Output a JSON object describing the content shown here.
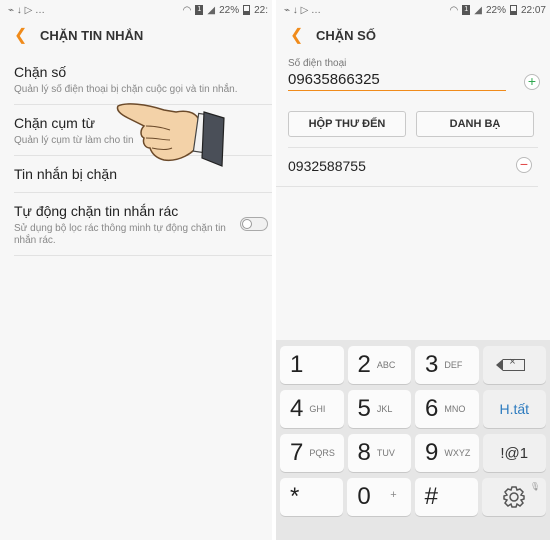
{
  "left": {
    "status": {
      "left_icons": "⌁ ↓ ▷ …",
      "battery": "22%",
      "time": "22:"
    },
    "title": "CHẶN TIN NHẮN",
    "rows": [
      {
        "title": "Chặn số",
        "subtitle": "Quản lý số điện thoại bị chặn cuộc gọi và tin nhắn."
      },
      {
        "title": "Chặn cụm từ",
        "subtitle": "Quản lý cụm từ làm cho tin"
      },
      {
        "title": "Tin nhắn bị chặn",
        "subtitle": ""
      },
      {
        "title": "Tự động chặn tin nhắn rác",
        "subtitle": "Sử dụng bộ lọc rác thông minh tự động chặn tin nhắn rác."
      }
    ],
    "auto_block_toggle": "off"
  },
  "right": {
    "status": {
      "left_icons": "⌁ ↓ ▷ …",
      "battery": "22%",
      "time": "22:07"
    },
    "title": "CHẶN SỐ",
    "phone_label": "Số điện thoại",
    "phone_value": "09635866325",
    "add_symbol": "+",
    "inbox_button": "HỘP THƯ ĐẾN",
    "contacts_button": "DANH BẠ",
    "blocked_numbers": [
      {
        "number": "0932588755",
        "remove_symbol": "−"
      }
    ],
    "keyboard": {
      "rows": [
        [
          {
            "digit": "1",
            "letters": ""
          },
          {
            "digit": "2",
            "letters": "ABC"
          },
          {
            "digit": "3",
            "letters": "DEF"
          }
        ],
        [
          {
            "digit": "4",
            "letters": "GHI"
          },
          {
            "digit": "5",
            "letters": "JKL"
          },
          {
            "digit": "6",
            "letters": "MNO"
          }
        ],
        [
          {
            "digit": "7",
            "letters": "PQRS"
          },
          {
            "digit": "8",
            "letters": "TUV"
          },
          {
            "digit": "9",
            "letters": "WXYZ"
          }
        ]
      ],
      "star": "*",
      "zero": "0",
      "zero_extra": "+",
      "hash": "#",
      "htat": "H.tất",
      "symbols": "!@1",
      "accent_color": "#2d7bbf"
    }
  },
  "colors": {
    "accent": "#f08b1b",
    "add": "#2fa84f",
    "remove": "#e04545"
  }
}
